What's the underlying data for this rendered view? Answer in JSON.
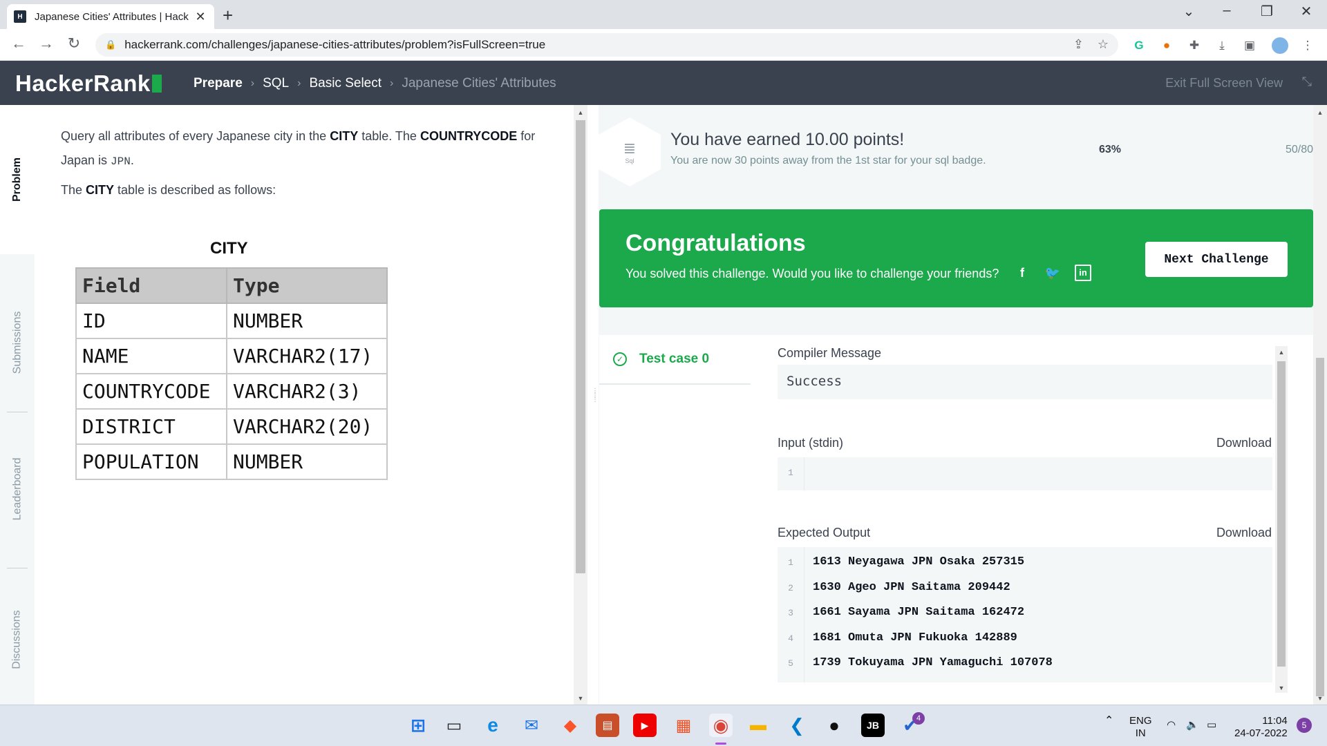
{
  "browser": {
    "tab_title": "Japanese Cities' Attributes | Hack",
    "url": "hackerrank.com/challenges/japanese-cities-attributes/problem?isFullScreen=true",
    "favicon_text": "H"
  },
  "header": {
    "logo": "HackerRank",
    "breadcrumbs": [
      "Prepare",
      "SQL",
      "Basic Select",
      "Japanese Cities' Attributes"
    ],
    "exit_fullscreen": "Exit Full Screen View"
  },
  "sidebar_tabs": [
    "Problem",
    "Submissions",
    "Leaderboard",
    "Discussions"
  ],
  "problem": {
    "intro_1": "Query all attributes of every Japanese city in the ",
    "intro_city": "CITY",
    "intro_2": " table. The ",
    "intro_cc": "COUNTRYCODE",
    "intro_3": " for Japan is ",
    "intro_jpn": "JPN",
    "intro_4": ".",
    "desc_1": "The ",
    "desc_city": "CITY",
    "desc_2": " table is described as follows:",
    "table_title": "CITY",
    "table_headers": [
      "Field",
      "Type"
    ],
    "table_rows": [
      [
        "ID",
        "NUMBER"
      ],
      [
        "NAME",
        "VARCHAR2(17)"
      ],
      [
        "COUNTRYCODE",
        "VARCHAR2(3)"
      ],
      [
        "DISTRICT",
        "VARCHAR2(20)"
      ],
      [
        "POPULATION",
        "NUMBER"
      ]
    ]
  },
  "points": {
    "badge_label": "Sql",
    "earned": "You have earned 10.00 points!",
    "away": "You are now 30 points away from the 1st star for your sql badge.",
    "percent": "63%",
    "progress": "50/80"
  },
  "congrats": {
    "title": "Congratulations",
    "subtitle": "You solved this challenge. Would you like to challenge your friends?",
    "next_button": "Next Challenge",
    "bg_color": "#1ba94c"
  },
  "results": {
    "test_case": "Test case 0",
    "compiler_label": "Compiler Message",
    "compiler_value": "Success",
    "input_label": "Input (stdin)",
    "download": "Download",
    "input_lines": [
      "1"
    ],
    "expected_label": "Expected Output",
    "expected_lines": [
      "1613 Neyagawa JPN Osaka 257315",
      "1630 Ageo JPN Saitama 209442",
      "1661 Sayama JPN Saitama 162472",
      "1681 Omuta JPN Fukuoka 142889",
      "1739 Tokuyama JPN Yamaguchi 107078"
    ]
  },
  "taskbar": {
    "lang": "ENG",
    "region": "IN",
    "time": "11:04",
    "date": "24-07-2022",
    "notif_count": "5",
    "todo_badge": "4",
    "jb_label": "JB"
  }
}
